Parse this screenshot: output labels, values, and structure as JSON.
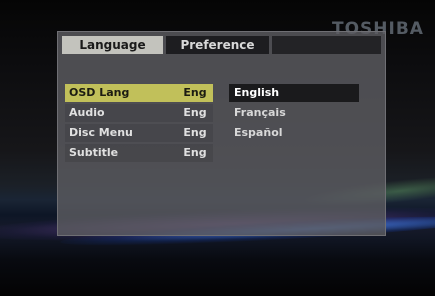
{
  "brand": "TOSHIBA",
  "tabs": [
    {
      "label": "Language",
      "active": true
    },
    {
      "label": "Preference",
      "active": false
    }
  ],
  "settings": [
    {
      "label": "OSD Lang",
      "value": "Eng",
      "selected": true
    },
    {
      "label": "Audio",
      "value": "Eng",
      "selected": false
    },
    {
      "label": "Disc Menu",
      "value": "Eng",
      "selected": false
    },
    {
      "label": "Subtitle",
      "value": "Eng",
      "selected": false
    }
  ],
  "options": [
    {
      "label": "English",
      "selected": true
    },
    {
      "label": "Français",
      "selected": false
    },
    {
      "label": "Español",
      "selected": false
    }
  ],
  "colors": {
    "highlight": "#c1c05a",
    "active_tab": "#c3c3bd",
    "option_highlight": "#1a1a1c"
  }
}
